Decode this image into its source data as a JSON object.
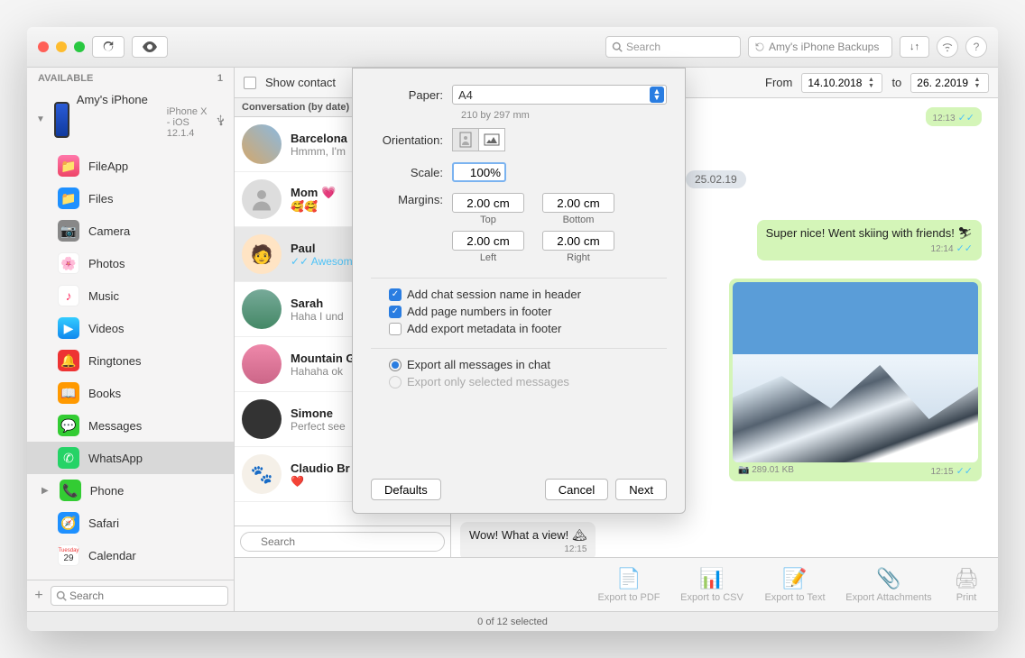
{
  "toolbar": {
    "search_placeholder": "Search",
    "backups_label": "Amy's iPhone Backups"
  },
  "sidebar": {
    "header": "AVAILABLE",
    "count": "1",
    "device": {
      "name": "Amy's iPhone",
      "subtitle": "iPhone X - iOS 12.1.4"
    },
    "items": [
      {
        "label": "FileApp"
      },
      {
        "label": "Files"
      },
      {
        "label": "Camera"
      },
      {
        "label": "Photos"
      },
      {
        "label": "Music"
      },
      {
        "label": "Videos"
      },
      {
        "label": "Ringtones"
      },
      {
        "label": "Books"
      },
      {
        "label": "Messages"
      },
      {
        "label": "WhatsApp"
      },
      {
        "label": "Phone"
      },
      {
        "label": "Safari"
      },
      {
        "label": "Calendar"
      }
    ],
    "search_placeholder": "Search"
  },
  "header": {
    "show_contact": "Show contact",
    "from": "From",
    "to": "to",
    "date_from": "14.10.2018",
    "date_to": "26.  2.2019"
  },
  "conversations": {
    "header": "Conversation (by date)",
    "items": [
      {
        "name": "Barcelona",
        "preview": "Hmmm, I'm"
      },
      {
        "name": "Mom 💗",
        "preview": "🥰🥰"
      },
      {
        "name": "Paul",
        "preview": "✓✓ Awesome"
      },
      {
        "name": "Sarah",
        "preview": "Haha I und"
      },
      {
        "name": "Mountain G",
        "preview": "Hahaha ok"
      },
      {
        "name": "Simone",
        "preview": "Perfect see"
      },
      {
        "name": "Claudio Br",
        "preview": "❤️"
      }
    ],
    "search_placeholder": "Search"
  },
  "chat": {
    "date_badge": "25.02.19",
    "msg1_time": "12:13",
    "msg2_text": "Super nice! Went skiing with friends! ⛷",
    "msg2_time": "12:14",
    "img_size": "289.01 KB",
    "img_time": "12:15",
    "in_msg": "Wow! What a view! 🏔",
    "in_time": "12:15"
  },
  "footer": {
    "items": [
      "Export to PDF",
      "Export to CSV",
      "Export to Text",
      "Export Attachments",
      "Print"
    ]
  },
  "status": "0 of 12 selected",
  "dialog": {
    "paper_label": "Paper:",
    "paper_value": "A4",
    "paper_sub": "210 by 297 mm",
    "orientation_label": "Orientation:",
    "scale_label": "Scale:",
    "scale_value": "100%",
    "margins_label": "Margins:",
    "margins": {
      "top": {
        "v": "2.00 cm",
        "l": "Top"
      },
      "bottom": {
        "v": "2.00 cm",
        "l": "Bottom"
      },
      "left": {
        "v": "2.00 cm",
        "l": "Left"
      },
      "right": {
        "v": "2.00 cm",
        "l": "Right"
      }
    },
    "chk_session": "Add chat session name in header",
    "chk_pagenum": "Add page numbers in footer",
    "chk_metadata": "Add export metadata in footer",
    "radio_all": "Export all messages in chat",
    "radio_sel": "Export only selected messages",
    "defaults": "Defaults",
    "cancel": "Cancel",
    "next": "Next"
  }
}
